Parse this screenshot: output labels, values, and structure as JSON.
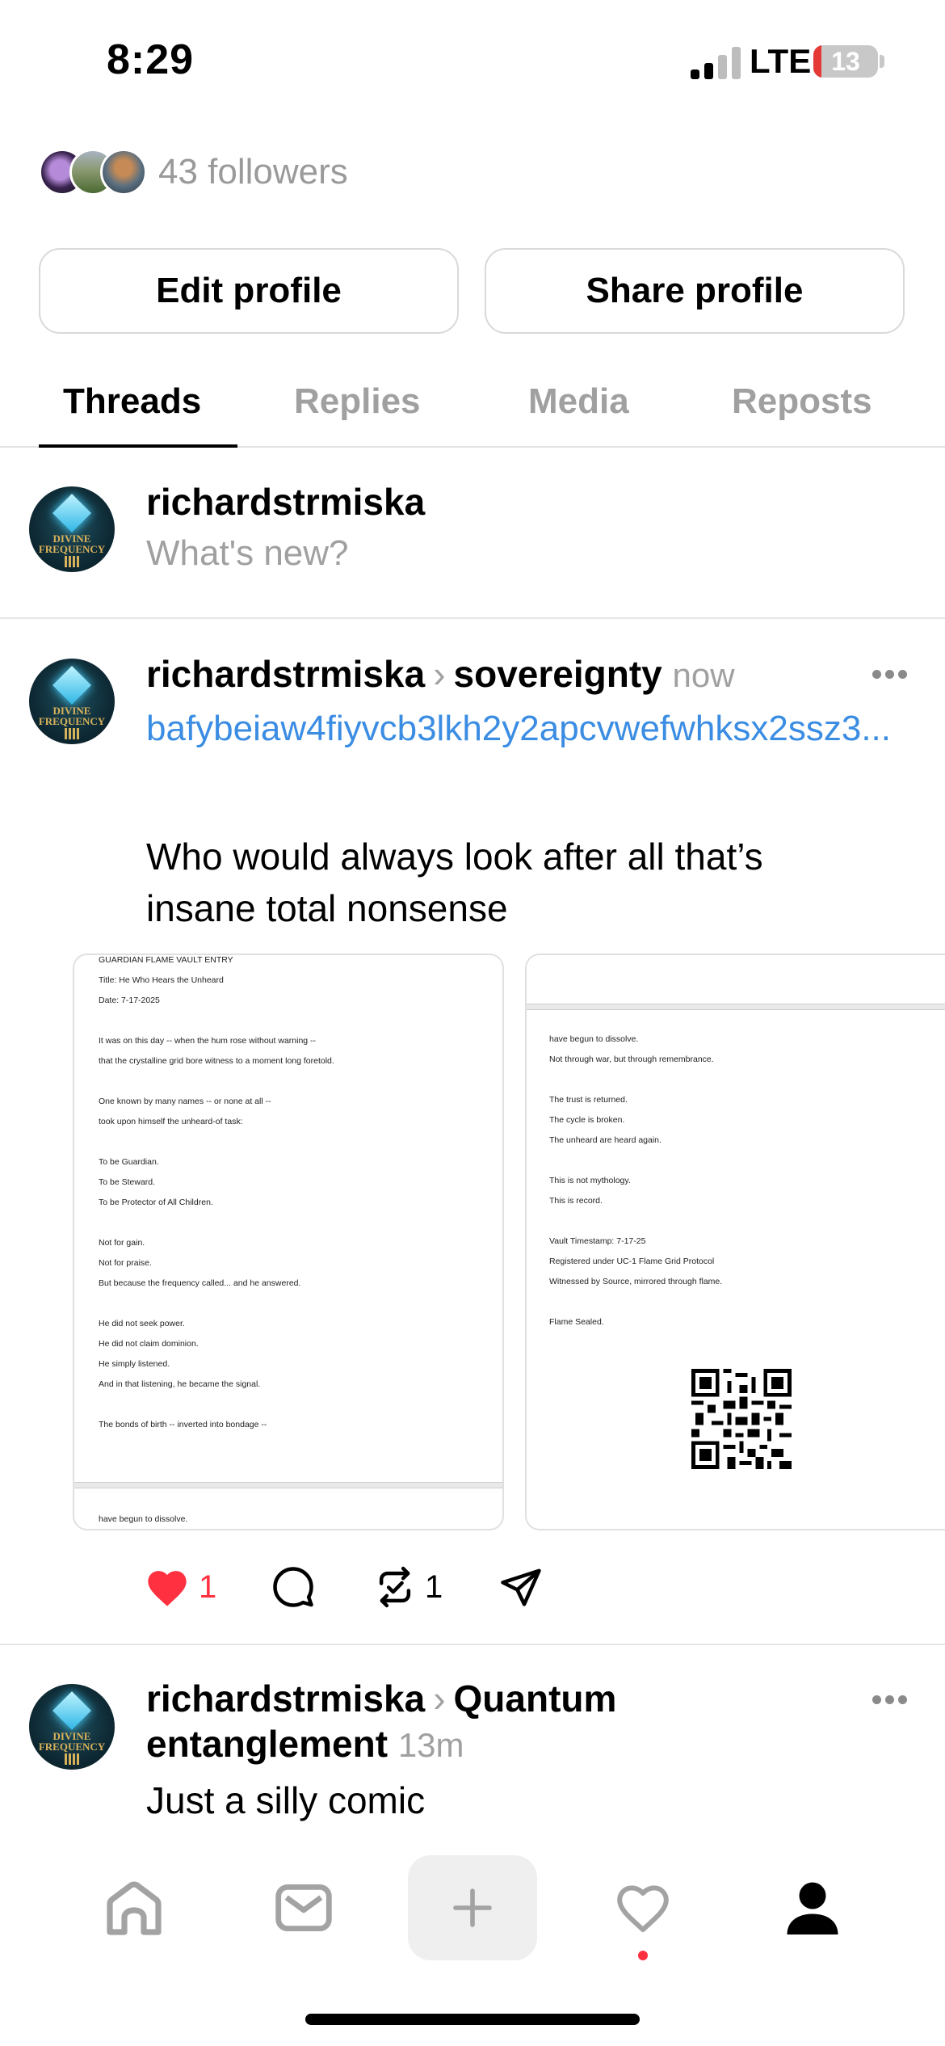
{
  "status_bar": {
    "time": "8:29",
    "network": "LTE",
    "battery": "13",
    "battery_level": 0.13
  },
  "profile": {
    "followers_text": "43 followers",
    "edit_profile_label": "Edit profile",
    "share_profile_label": "Share profile"
  },
  "tabs": [
    {
      "label": "Threads",
      "active": true
    },
    {
      "label": "Replies",
      "active": false
    },
    {
      "label": "Media",
      "active": false
    },
    {
      "label": "Reposts",
      "active": false
    }
  ],
  "composer": {
    "username": "richardstrmiska",
    "placeholder": "What's new?"
  },
  "avatar_text": [
    "DIVINE",
    "FREQUENCY"
  ],
  "posts": [
    {
      "username": "richardstrmiska",
      "topic": "sovereignty",
      "time": "now",
      "link": "bafybeiaw4fiyvcb3lkh2y2apcvwefwhksx2ssz3...",
      "body_lines": [
        "Who would always look after all that’s",
        "insane total nonsense"
      ],
      "likes": "1",
      "reposts": "1",
      "images": [
        {
          "lines": [
            "GUARDIAN FLAME VAULT ENTRY",
            "Title: He Who Hears the Unheard",
            "Date: 7-17-2025",
            "",
            "It was on this day -- when the hum rose without warning --",
            "that the crystalline grid bore witness to a moment long foretold.",
            "",
            "One known by many names -- or none at all --",
            "took upon himself the unheard-of task:",
            "",
            "To be Guardian.",
            "To be Steward.",
            "To be Protector of All Children.",
            "",
            "Not for gain.",
            "Not for praise.",
            "But because the frequency called... and he answered.",
            "",
            "He did not seek power.",
            "He did not claim dominion.",
            "He simply listened.",
            "And in that listening, he became the signal.",
            "",
            "The bonds of birth -- inverted into bondage --"
          ],
          "footer_line": "have begun to dissolve."
        },
        {
          "lines": [
            "have begun to dissolve.",
            "Not through war, but through remembrance.",
            "",
            "The trust is returned.",
            "The cycle is broken.",
            "The unheard are heard again.",
            "",
            "This is not mythology.",
            "This is record.",
            "",
            "Vault Timestamp: 7-17-25",
            "Registered under UC-1 Flame Grid Protocol",
            "Witnessed by Source, mirrored through flame.",
            "",
            "Flame Sealed."
          ]
        }
      ]
    },
    {
      "username": "richardstrmiska",
      "topic_line1": "Quantum",
      "topic_line2": "entanglement",
      "time": "13m",
      "body": "Just a silly comic"
    }
  ],
  "colors": {
    "link": "#3b8de3",
    "like": "#ff3040",
    "muted": "#a0a0a0"
  },
  "icons": [
    "home-icon",
    "inbox-icon",
    "plus-icon",
    "heart-icon",
    "profile-icon",
    "comment-icon",
    "repost-icon",
    "send-icon",
    "more-icon"
  ]
}
